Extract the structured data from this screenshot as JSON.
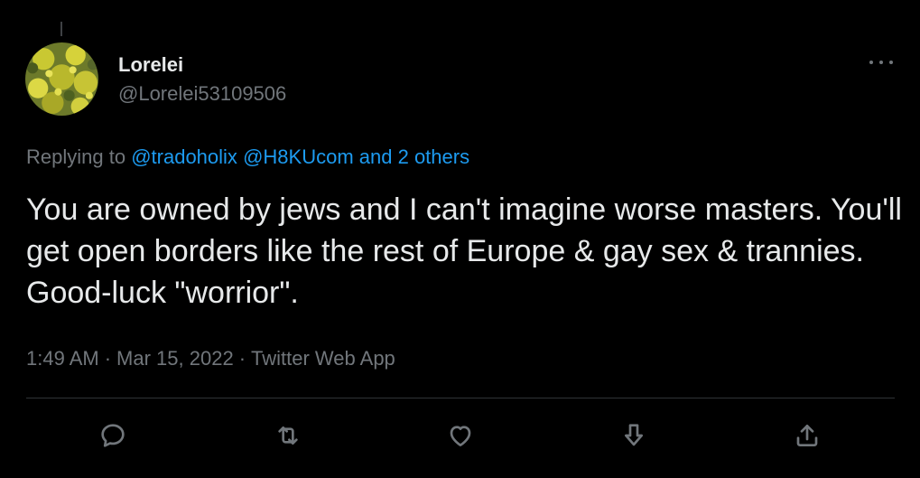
{
  "tweet": {
    "author": {
      "display_name": "Lorelei",
      "handle": "@Lorelei53109506",
      "avatar_icon": "avatar-yellow-flowers"
    },
    "replying": {
      "prefix": "Replying to",
      "mention_1": "@tradoholix",
      "mention_2": "@H8KUcom",
      "others": "and 2 others"
    },
    "text": "You are owned by jews and I can't imagine worse masters. You'll get open borders like the rest of Europe & gay sex & trannies. Good-luck \"worrior\".",
    "meta": {
      "time": "1:49 AM",
      "separator": "·",
      "date": "Mar 15, 2022",
      "source": "Twitter Web App"
    },
    "actions": {
      "reply_icon": "reply-icon",
      "retweet_icon": "retweet-icon",
      "like_icon": "heart-icon",
      "share_icon": "share-icon",
      "upload_icon": "upload-icon"
    },
    "more_icon": "more-icon"
  },
  "colors": {
    "background": "#000000",
    "text_primary": "#e7e9ea",
    "text_secondary": "#71767b",
    "accent": "#1d9bf0",
    "divider": "#2f3336"
  }
}
